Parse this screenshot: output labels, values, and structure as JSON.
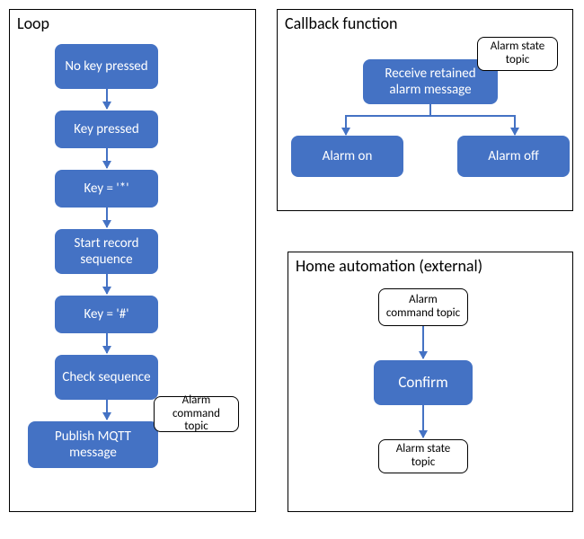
{
  "loop": {
    "title": "Loop",
    "nodes": {
      "n1": "No key pressed",
      "n2": "Key pressed",
      "n3": "Key = '*'",
      "n4": "Start record sequence",
      "n5": "Key = '#'",
      "n6": "Check sequence",
      "n7": "Publish MQTT message"
    },
    "tag": "Alarm command topic"
  },
  "callback": {
    "title": "Callback function",
    "nodes": {
      "receive": "Receive retained alarm message",
      "on": "Alarm on",
      "off": "Alarm off"
    },
    "tag": "Alarm state topic"
  },
  "home": {
    "title": "Home automation (external)",
    "tags": {
      "cmd": "Alarm command topic",
      "state": "Alarm state topic"
    },
    "node": "Confirm"
  }
}
